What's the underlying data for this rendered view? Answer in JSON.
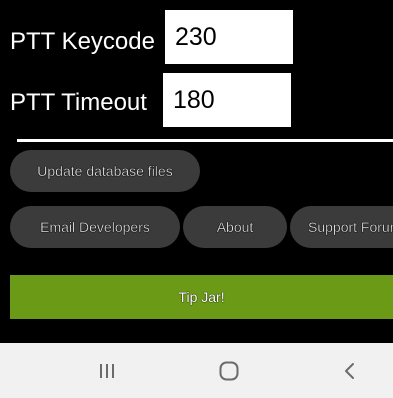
{
  "settings": {
    "ptt_keycode_label": "PTT Keycode",
    "ptt_keycode_value": "230",
    "ptt_timeout_label": "PTT Timeout",
    "ptt_timeout_value": "180"
  },
  "buttons": {
    "update_db": "Update database files",
    "email_devs": "Email Developers",
    "about": "About",
    "support_forum": "Support Forum",
    "tip_jar": "Tip Jar!"
  },
  "navbar": {
    "recents_icon": "recents-icon",
    "home_icon": "home-icon",
    "back_icon": "back-icon"
  },
  "colors": {
    "background": "#000000",
    "pill": "#3b3b3b",
    "tip_jar": "#6b9a16",
    "navbar": "#f1f1f1"
  }
}
